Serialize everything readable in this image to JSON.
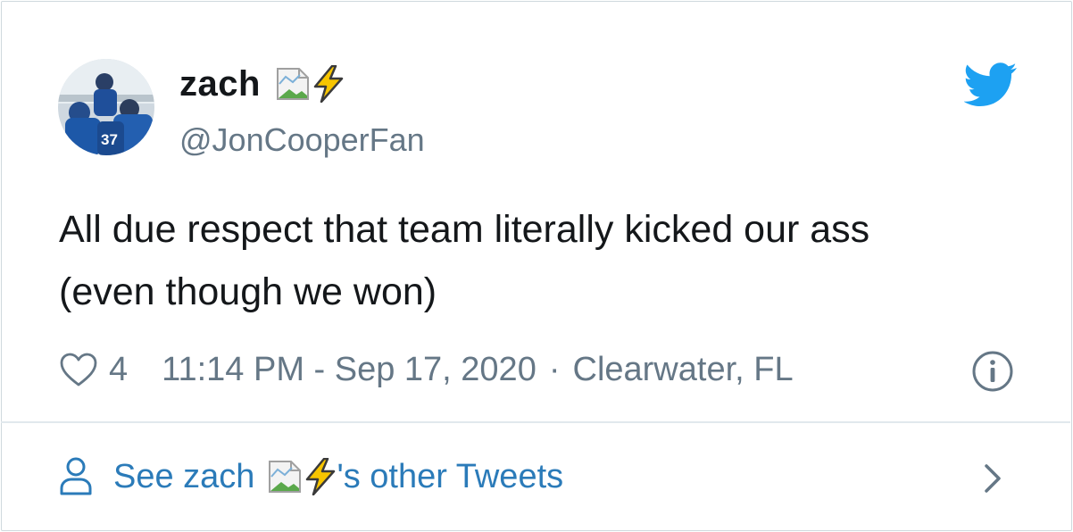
{
  "author": {
    "display_name": "zach",
    "handle": "@JonCooperFan",
    "avatar_jersey_number": "37"
  },
  "tweet": {
    "text_line1": "All due respect that team literally kicked our ass",
    "text_line2": "(even though we won)",
    "likes": "4",
    "timestamp": "11:14 PM - Sep 17, 2020",
    "separator": "·",
    "location": "Clearwater, FL"
  },
  "footer": {
    "prefix": "See zach",
    "suffix": "'s other Tweets"
  },
  "icons": {
    "brand": "twitter-bird-icon",
    "like": "heart-icon",
    "info": "info-icon",
    "person": "person-icon",
    "chevron": "chevron-right-icon",
    "emoji": "lightning-bolt-emoji",
    "broken_image": "broken-image-icon"
  },
  "colors": {
    "twitter_blue": "#1da1f2",
    "link_blue": "#2b7bb9",
    "text": "#14171a",
    "muted": "#657786",
    "border": "#cfd9de"
  }
}
